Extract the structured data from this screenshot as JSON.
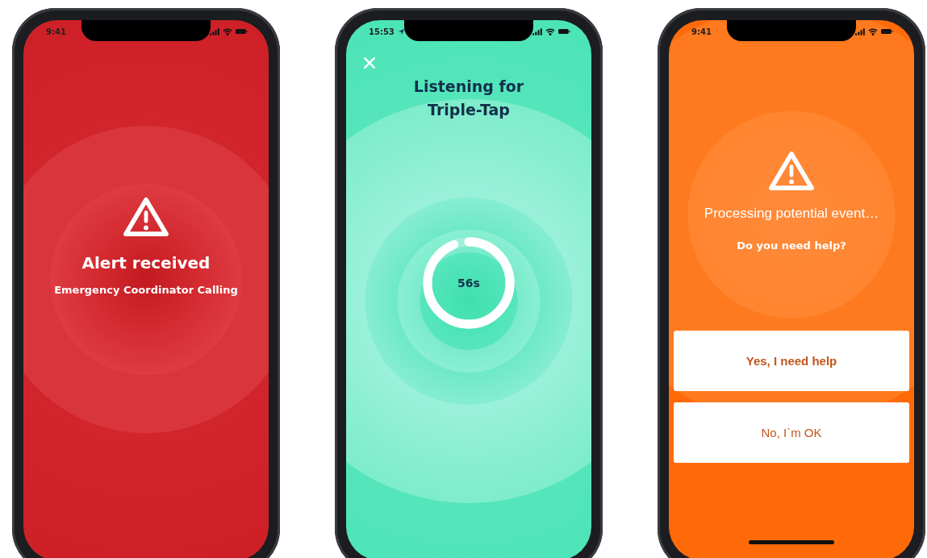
{
  "phones": [
    {
      "kind": "alert",
      "status_time": "9:41",
      "location_services": false,
      "title": "Alert received",
      "subtitle": "Emergency Coordinator Calling"
    },
    {
      "kind": "listening",
      "status_time": "15:53",
      "location_services": true,
      "title": "Listening for Triple-Tap",
      "countdown": "56s",
      "level": 0.94
    },
    {
      "kind": "question",
      "status_time": "9:41",
      "location_services": false,
      "title": "Processing potential event…",
      "question": "Do you need help?",
      "buttons": [
        {
          "label": "Yes, I need help",
          "primary": true
        },
        {
          "label": "No, I`m OK",
          "primary": false
        }
      ]
    }
  ]
}
